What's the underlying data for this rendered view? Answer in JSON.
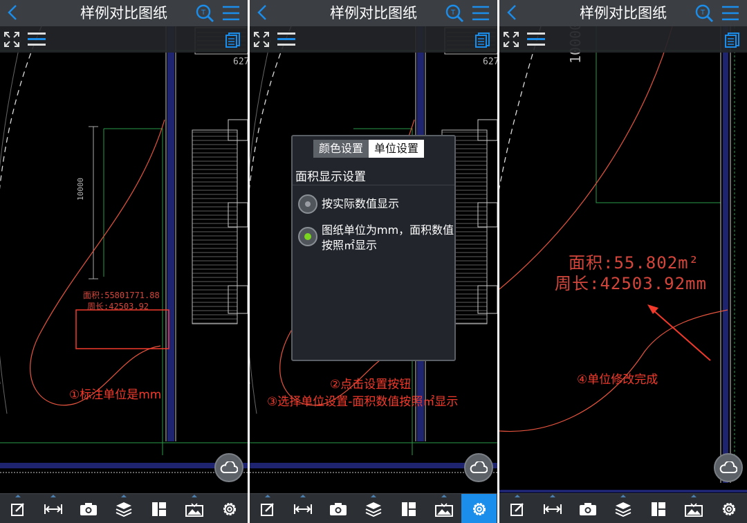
{
  "app": {
    "title": "样例对比图纸"
  },
  "panels": [
    {
      "cad_labels": {
        "area": "面积:55801771.88",
        "perimeter": "周长:42503.92",
        "dimension": "10000",
        "edge_number": "627"
      },
      "annotations": [
        "①标注单位是mm"
      ]
    },
    {
      "cad_labels": {
        "edge_number": "627"
      },
      "annotations": [
        "②点击设置按钮",
        "③选择单位设置-面积数值按照㎡显示"
      ],
      "dialog": {
        "tabs": [
          "颜色设置",
          "单位设置"
        ],
        "active_tab": "单位设置",
        "heading": "面积显示设置",
        "options": [
          "按实际数值显示",
          "图纸单位为mm，面积数值按照㎡显示"
        ],
        "selected_option": "图纸单位为mm，面积数值按照㎡显示"
      }
    },
    {
      "cad_labels": {
        "area": "面积:55.802m²",
        "perimeter": "周长:42503.92mm",
        "dimension": "10000"
      },
      "annotations": [
        "④单位修改完成"
      ]
    }
  ],
  "toolbar_icons": [
    "edit-icon",
    "measure-icon",
    "camera-icon",
    "layers-icon",
    "layout-icon",
    "image-icon",
    "gear-icon"
  ],
  "active_toolbar": [
    null,
    "gear-icon",
    null
  ],
  "colors": {
    "accent": "#1b8dea",
    "annotation": "#f23a2c",
    "cad_line": "#e8553f",
    "title_bar": "#3b3f44"
  }
}
